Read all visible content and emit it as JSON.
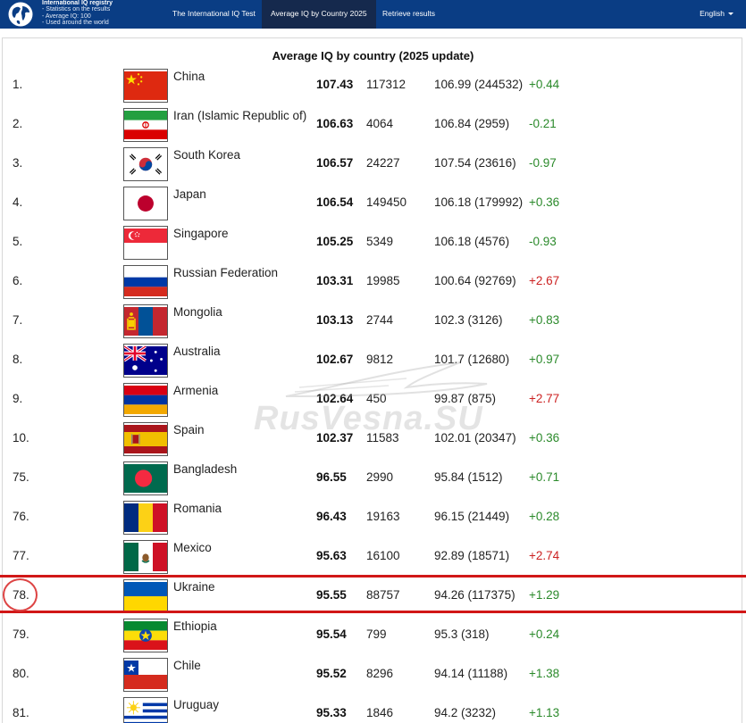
{
  "nav": {
    "brand_lines": [
      "International IQ registry",
      "- Statistics on the results",
      "- Average IQ: 100",
      "- Used around the world"
    ],
    "items": [
      {
        "label": "The International IQ Test"
      },
      {
        "label": "Average IQ by Country 2025"
      },
      {
        "label": "Retrieve results"
      }
    ],
    "language": "English"
  },
  "page": {
    "title": "Average IQ by country (2025 update)",
    "watermark": "RusVesna.SU"
  },
  "colors": {
    "nav_bg": "#0a3d84",
    "nav_active_bg": "#15294d",
    "positive_delta": "#2b8a2b",
    "negative_delta": "#cc2222",
    "highlight": "#d11717"
  },
  "rows": [
    {
      "rank": "1.",
      "flag": "china-flag",
      "country": "China",
      "iq": "107.43",
      "count": "117312",
      "prev": "106.99 (244532)",
      "delta": "+0.44",
      "dir": "up"
    },
    {
      "rank": "2.",
      "flag": "iran-flag",
      "country": "Iran (Islamic Republic of)",
      "iq": "106.63",
      "count": "4064",
      "prev": "106.84 (2959)",
      "delta": "-0.21",
      "dir": "up"
    },
    {
      "rank": "3.",
      "flag": "south-korea-flag",
      "country": "South Korea",
      "iq": "106.57",
      "count": "24227",
      "prev": "107.54 (23616)",
      "delta": "-0.97",
      "dir": "up"
    },
    {
      "rank": "4.",
      "flag": "japan-flag",
      "country": "Japan",
      "iq": "106.54",
      "count": "149450",
      "prev": "106.18 (179992)",
      "delta": "+0.36",
      "dir": "up"
    },
    {
      "rank": "5.",
      "flag": "singapore-flag",
      "country": "Singapore",
      "iq": "105.25",
      "count": "5349",
      "prev": "106.18 (4576)",
      "delta": "-0.93",
      "dir": "up"
    },
    {
      "rank": "6.",
      "flag": "russia-flag",
      "country": "Russian Federation",
      "iq": "103.31",
      "count": "19985",
      "prev": "100.64 (92769)",
      "delta": "+2.67",
      "dir": "down"
    },
    {
      "rank": "7.",
      "flag": "mongolia-flag",
      "country": "Mongolia",
      "iq": "103.13",
      "count": "2744",
      "prev": "102.3 (3126)",
      "delta": "+0.83",
      "dir": "up"
    },
    {
      "rank": "8.",
      "flag": "australia-flag",
      "country": "Australia",
      "iq": "102.67",
      "count": "9812",
      "prev": "101.7 (12680)",
      "delta": "+0.97",
      "dir": "up"
    },
    {
      "rank": "9.",
      "flag": "armenia-flag",
      "country": "Armenia",
      "iq": "102.64",
      "count": "450",
      "prev": "99.87 (875)",
      "delta": "+2.77",
      "dir": "down"
    },
    {
      "rank": "10.",
      "flag": "spain-flag",
      "country": "Spain",
      "iq": "102.37",
      "count": "11583",
      "prev": "102.01 (20347)",
      "delta": "+0.36",
      "dir": "up"
    },
    {
      "rank": "75.",
      "flag": "bangladesh-flag",
      "country": "Bangladesh",
      "iq": "96.55",
      "count": "2990",
      "prev": "95.84 (1512)",
      "delta": "+0.71",
      "dir": "up"
    },
    {
      "rank": "76.",
      "flag": "romania-flag",
      "country": "Romania",
      "iq": "96.43",
      "count": "19163",
      "prev": "96.15 (21449)",
      "delta": "+0.28",
      "dir": "up"
    },
    {
      "rank": "77.",
      "flag": "mexico-flag",
      "country": "Mexico",
      "iq": "95.63",
      "count": "16100",
      "prev": "92.89 (18571)",
      "delta": "+2.74",
      "dir": "down"
    },
    {
      "rank": "78.",
      "flag": "ukraine-flag",
      "country": "Ukraine",
      "iq": "95.55",
      "count": "88757",
      "prev": "94.26 (117375)",
      "delta": "+1.29",
      "dir": "up",
      "highlighted": true
    },
    {
      "rank": "79.",
      "flag": "ethiopia-flag",
      "country": "Ethiopia",
      "iq": "95.54",
      "count": "799",
      "prev": "95.3 (318)",
      "delta": "+0.24",
      "dir": "up"
    },
    {
      "rank": "80.",
      "flag": "chile-flag",
      "country": "Chile",
      "iq": "95.52",
      "count": "8296",
      "prev": "94.14 (11188)",
      "delta": "+1.38",
      "dir": "up"
    },
    {
      "rank": "81.",
      "flag": "uruguay-flag",
      "country": "Uruguay",
      "iq": "95.33",
      "count": "1846",
      "prev": "94.2 (3232)",
      "delta": "+1.13",
      "dir": "up"
    }
  ]
}
